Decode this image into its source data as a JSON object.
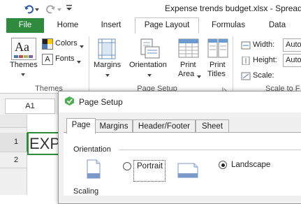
{
  "titlebar": {
    "title": "Expense trends budget.xlsx - Spread D"
  },
  "tabs": {
    "file": "File",
    "home": "Home",
    "insert": "Insert",
    "page_layout": "Page Layout",
    "formulas": "Formulas",
    "data": "Data"
  },
  "ribbon": {
    "themes": {
      "themes_label": "Themes",
      "themes_icon_text": "Aa",
      "colors_label": "Colors",
      "fonts_label": "Fonts",
      "group_label": "Themes"
    },
    "page_setup": {
      "margins_label": "Margins",
      "orientation_label": "Orientation",
      "print_area_line1": "Print",
      "print_area_line2": "Area",
      "print_titles_line1": "Print",
      "print_titles_line2": "Titles",
      "group_label": "Page Setup"
    },
    "scale": {
      "width_label": "Width:",
      "width_value": "Auto",
      "height_label": "Height:",
      "height_value": "Auto",
      "scale_label": "Scale:",
      "group_label": "Scale to F"
    }
  },
  "formula_bar": {
    "name_box": "A1"
  },
  "sheet": {
    "row1": "1",
    "row2": "2",
    "cell_a1": "EXP"
  },
  "dialog": {
    "title": "Page Setup",
    "tabs": [
      "Page",
      "Margins",
      "Header/Footer",
      "Sheet"
    ],
    "orientation_label": "Orientation",
    "portrait_label": "Portrait",
    "landscape_label": "Landscape",
    "scaling_label": "Scaling",
    "selected_orientation": "Landscape"
  },
  "colors": {
    "file_tab": "#2e8b3d",
    "dialog_icon": "#4caf50"
  }
}
